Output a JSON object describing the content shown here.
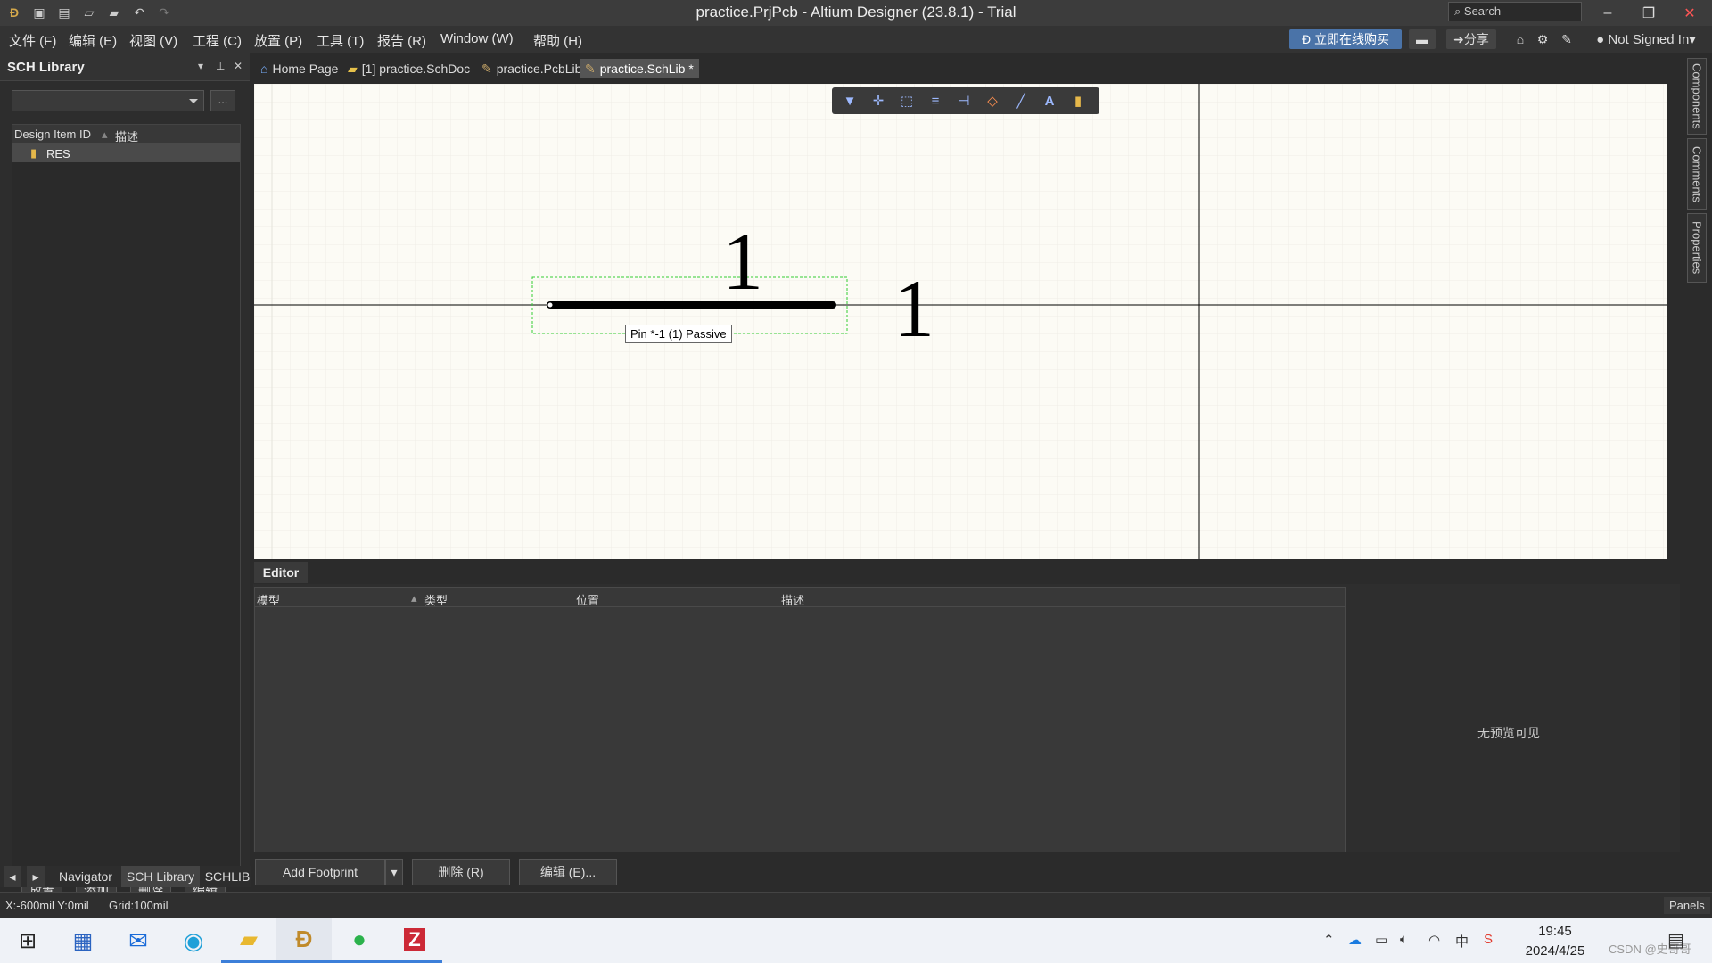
{
  "window": {
    "title": "practice.PrjPcb - Altium Designer (23.8.1) - Trial",
    "search_placeholder": "Search"
  },
  "menu": {
    "items": [
      "文件 (F)",
      "编辑 (E)",
      "视图 (V)",
      "工程 (C)",
      "放置 (P)",
      "工具 (T)",
      "报告 (R)",
      "Window (W)",
      "帮助 (H)"
    ],
    "buy": "立即在线购买",
    "share": "分享",
    "account": "Not Signed In"
  },
  "left_panel": {
    "title": "SCH Library",
    "more_button": "...",
    "columns": [
      "Design Item ID",
      "描述"
    ],
    "rows": [
      {
        "id": "RES",
        "desc": ""
      }
    ],
    "buttons": [
      "放置",
      "添加",
      "删除",
      "编辑"
    ],
    "bottom_tabs": [
      "Navigator",
      "SCH Library",
      "SCHLIB"
    ]
  },
  "doc_tabs": [
    {
      "label": "Home Page",
      "active": false
    },
    {
      "label": "[1] practice.SchDoc",
      "active": false
    },
    {
      "label": "practice.PcbLib",
      "active": false
    },
    {
      "label": "practice.SchLib *",
      "active": true
    }
  ],
  "canvas": {
    "pin_label_top": "1",
    "pin_label_right": "1",
    "tooltip": "Pin *-1 (1) Passive"
  },
  "editor": {
    "tab": "Editor",
    "columns": [
      "模型",
      "类型",
      "位置",
      "描述"
    ],
    "no_preview": "无预览可见",
    "add_footprint": "Add Footprint",
    "delete": "删除 (R)",
    "edit": "编辑 (E)..."
  },
  "right_tabs": [
    "Components",
    "Comments",
    "Properties"
  ],
  "status": {
    "coords": "X:-600mil Y:0mil",
    "grid": "Grid:100mil",
    "panels": "Panels"
  },
  "taskbar": {
    "time": "19:45",
    "date": "2024/4/25",
    "watermark": "CSDN @史哥哥"
  },
  "colors": {
    "accent": "#4a73a8",
    "canvas_bg": "#fcfbf5",
    "selection": "#00cc00"
  }
}
